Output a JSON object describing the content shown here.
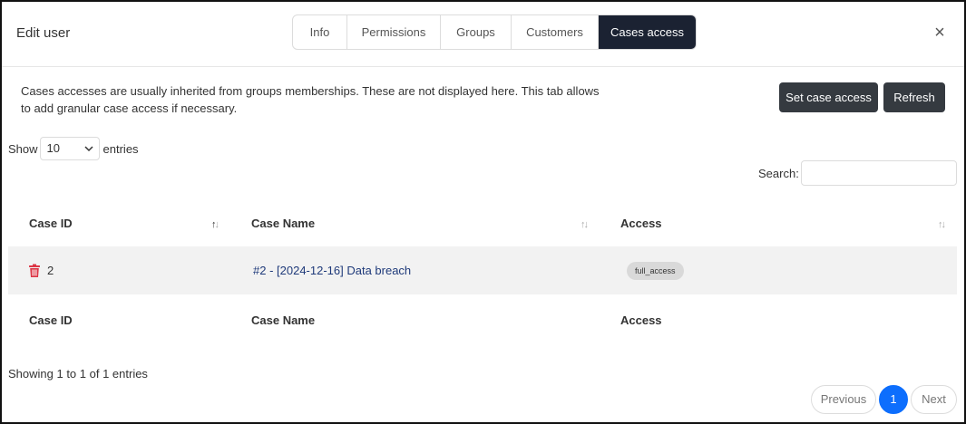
{
  "modal": {
    "title": "Edit user",
    "close_symbol": "×"
  },
  "tabs": [
    {
      "label": "Info"
    },
    {
      "label": "Permissions"
    },
    {
      "label": "Groups"
    },
    {
      "label": "Customers"
    },
    {
      "label": "Cases access",
      "active": true
    }
  ],
  "description": "Cases accesses are usually inherited from groups memberships. These are not displayed here. This tab allows to add granular case access if necessary.",
  "buttons": {
    "set_case_access": "Set case access",
    "refresh": "Refresh"
  },
  "length_menu": {
    "prefix": "Show",
    "value": "10",
    "suffix": "entries"
  },
  "search": {
    "label": "Search:",
    "value": ""
  },
  "table": {
    "columns": [
      "Case ID",
      "Case Name",
      "Access"
    ],
    "rows": [
      {
        "case_id": "2",
        "case_name": "#2 - [2024-12-16] Data breach",
        "access": "full_access"
      }
    ]
  },
  "footer": {
    "info": "Showing 1 to 1 of 1 entries",
    "previous": "Previous",
    "page": "1",
    "next": "Next"
  },
  "colors": {
    "accent": "#0d6efd",
    "dark": "#353a40",
    "active_tab": "#1b2232",
    "delete": "#dc3545"
  }
}
